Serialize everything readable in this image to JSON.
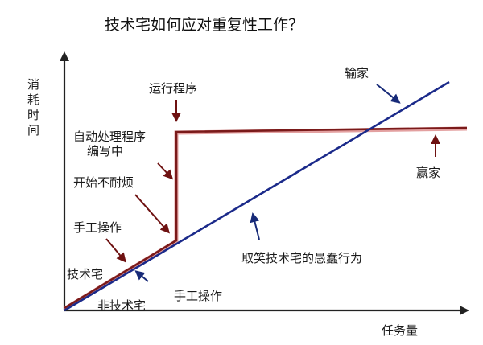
{
  "title": "技术宅如何应对重复性工作？",
  "axes": {
    "y_label": "消耗时间",
    "x_label": "任务量"
  },
  "annotations": {
    "run_program": "运行程序",
    "auto_program_line1": "自动处理程序",
    "auto_program_line2": "编写中",
    "start_annoyed": "开始不耐烦",
    "manual_red": "手工操作",
    "tech_otaku": "技术宅",
    "non_tech_otaku": "非技术宅",
    "manual_blue": "手工操作",
    "laugh": "取笑技术宅的愚蠢行为",
    "lose": "输家",
    "win": "赢家"
  },
  "colors": {
    "tech_line": "#7a1a1a",
    "tech_line_light": "#e3a0a0",
    "non_tech_line": "#1b2a8a",
    "axis": "#222222",
    "red_arrow": "#6e1111",
    "blue_arrow": "#172a78"
  }
}
